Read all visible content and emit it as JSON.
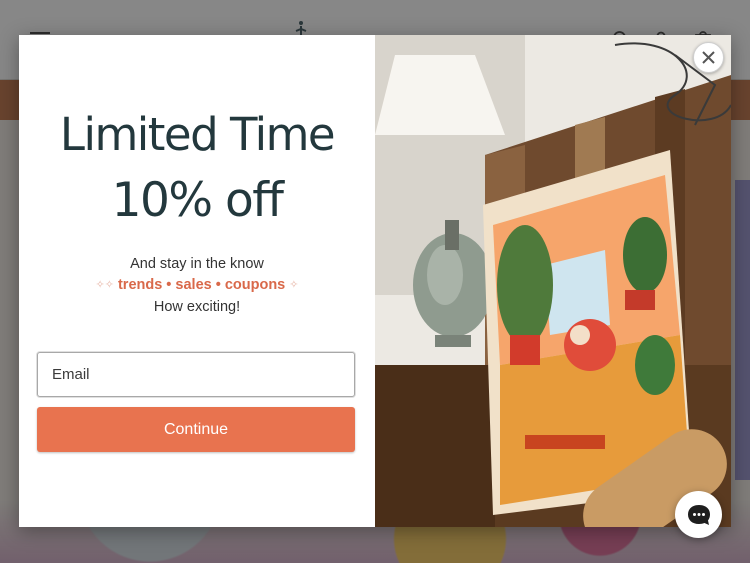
{
  "popup": {
    "headline": "Limited Time",
    "discount": "10% off",
    "subtitle": "And stay in the know",
    "perks": "trends • sales • coupons",
    "closing": "How exciting!",
    "email_placeholder": "Email",
    "email_value": "",
    "continue_label": "Continue"
  },
  "icons": {
    "close": "close-icon",
    "sparkle": "sparkle-icon",
    "chat": "chat-bubble-icon",
    "menu": "hamburger-icon",
    "search": "search-icon",
    "account": "account-icon",
    "cart": "cart-icon"
  },
  "colors": {
    "headline": "#23383d",
    "accent": "#d9694a",
    "button": "#e8734f",
    "overlay": "rgba(40,40,40,0.55)"
  }
}
